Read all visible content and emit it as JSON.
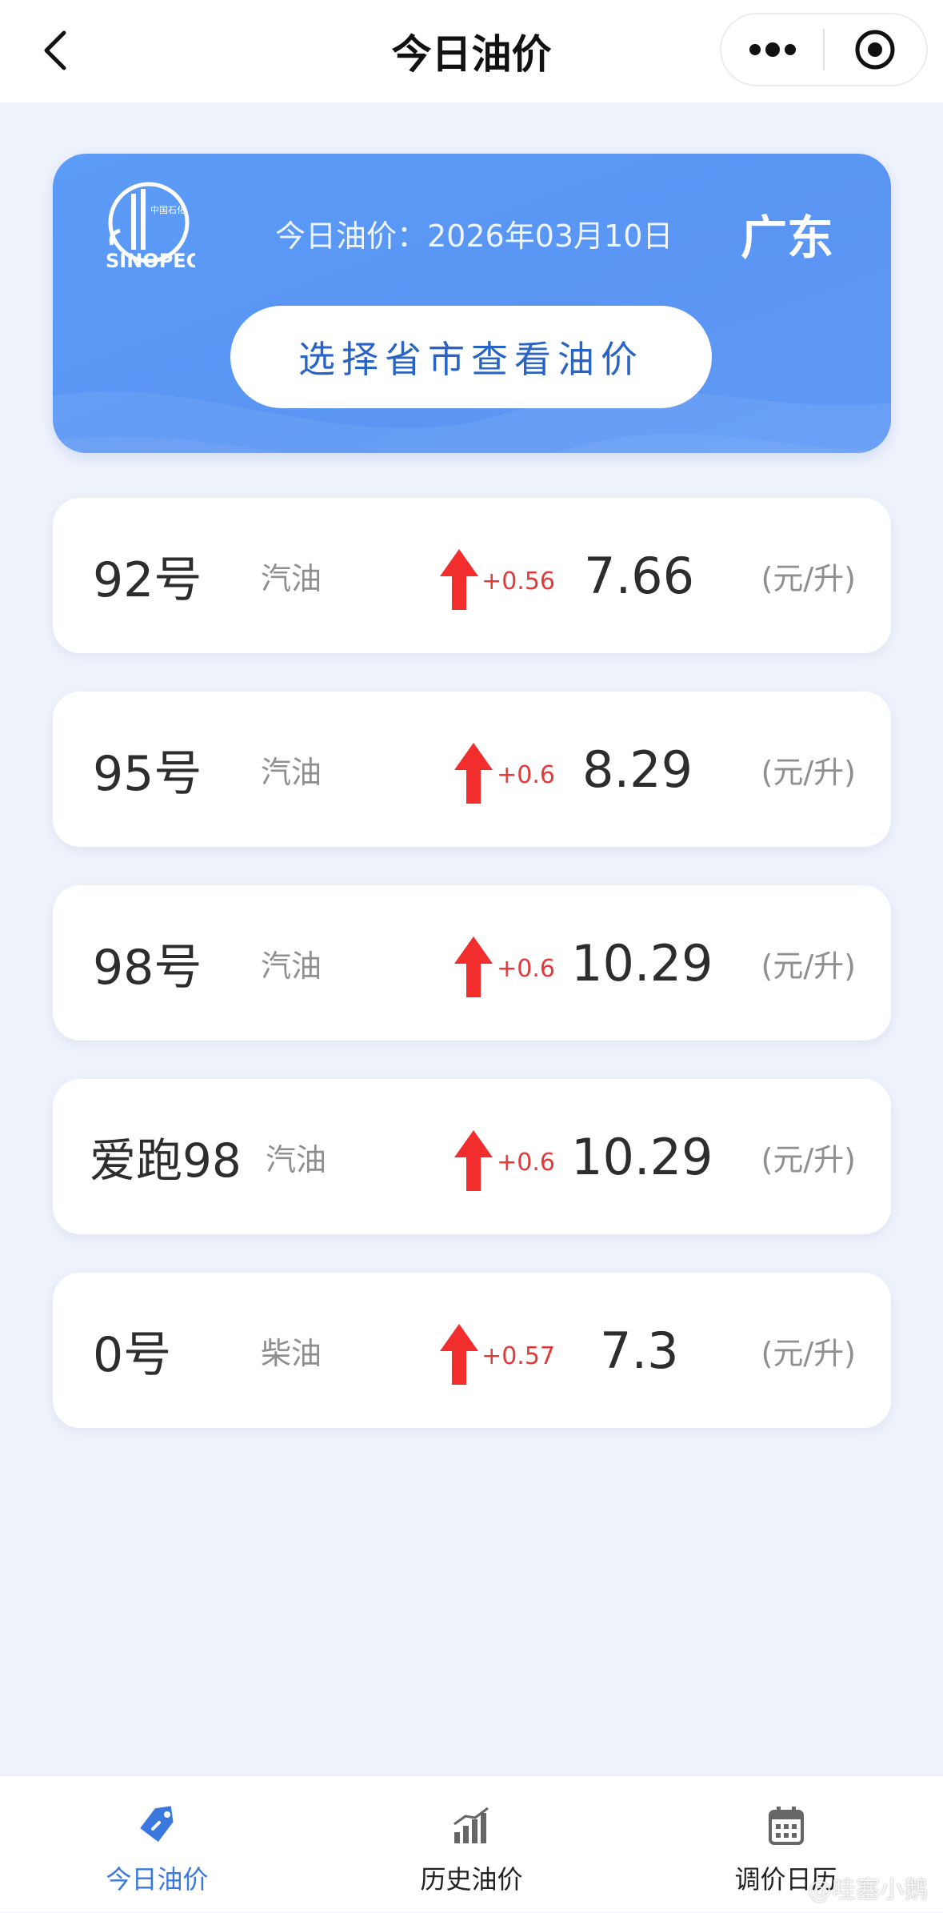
{
  "header": {
    "title": "今日油价",
    "back_icon": "chevron-left-icon",
    "more_icon": "more-dots-icon",
    "close_icon": "target-circle-icon"
  },
  "banner": {
    "logo_alt": "SINOPEC",
    "date_text": "今日油价：2026年03月10日",
    "province": "广东",
    "select_button": "选择省市查看油价",
    "background_color": "#5b9cf7"
  },
  "prices": [
    {
      "grade": "92号",
      "fuel": "汽油",
      "change": "+0.56",
      "price": "7.66",
      "unit": "(元/升)"
    },
    {
      "grade": "95号",
      "fuel": "汽油",
      "change": "+0.6",
      "price": "8.29",
      "unit": "(元/升)"
    },
    {
      "grade": "98号",
      "fuel": "汽油",
      "change": "+0.6",
      "price": "10.29",
      "unit": "(元/升)"
    },
    {
      "grade": "爱跑98",
      "fuel": "汽油",
      "change": "+0.6",
      "price": "10.29",
      "unit": "(元/升)"
    },
    {
      "grade": "0号",
      "fuel": "柴油",
      "change": "+0.57",
      "price": "7.3",
      "unit": "(元/升)"
    }
  ],
  "colors": {
    "up_arrow": "#f22d2d",
    "change_text": "#e23a3a",
    "active_tab": "#3a78e0"
  },
  "tabbar": {
    "tabs": [
      {
        "label": "今日油价",
        "icon": "price-tag-icon",
        "active": true
      },
      {
        "label": "历史油价",
        "icon": "bar-chart-icon",
        "active": false
      },
      {
        "label": "调价日历",
        "icon": "calendar-icon",
        "active": false
      }
    ]
  },
  "watermark": "@哇塞小鹅"
}
